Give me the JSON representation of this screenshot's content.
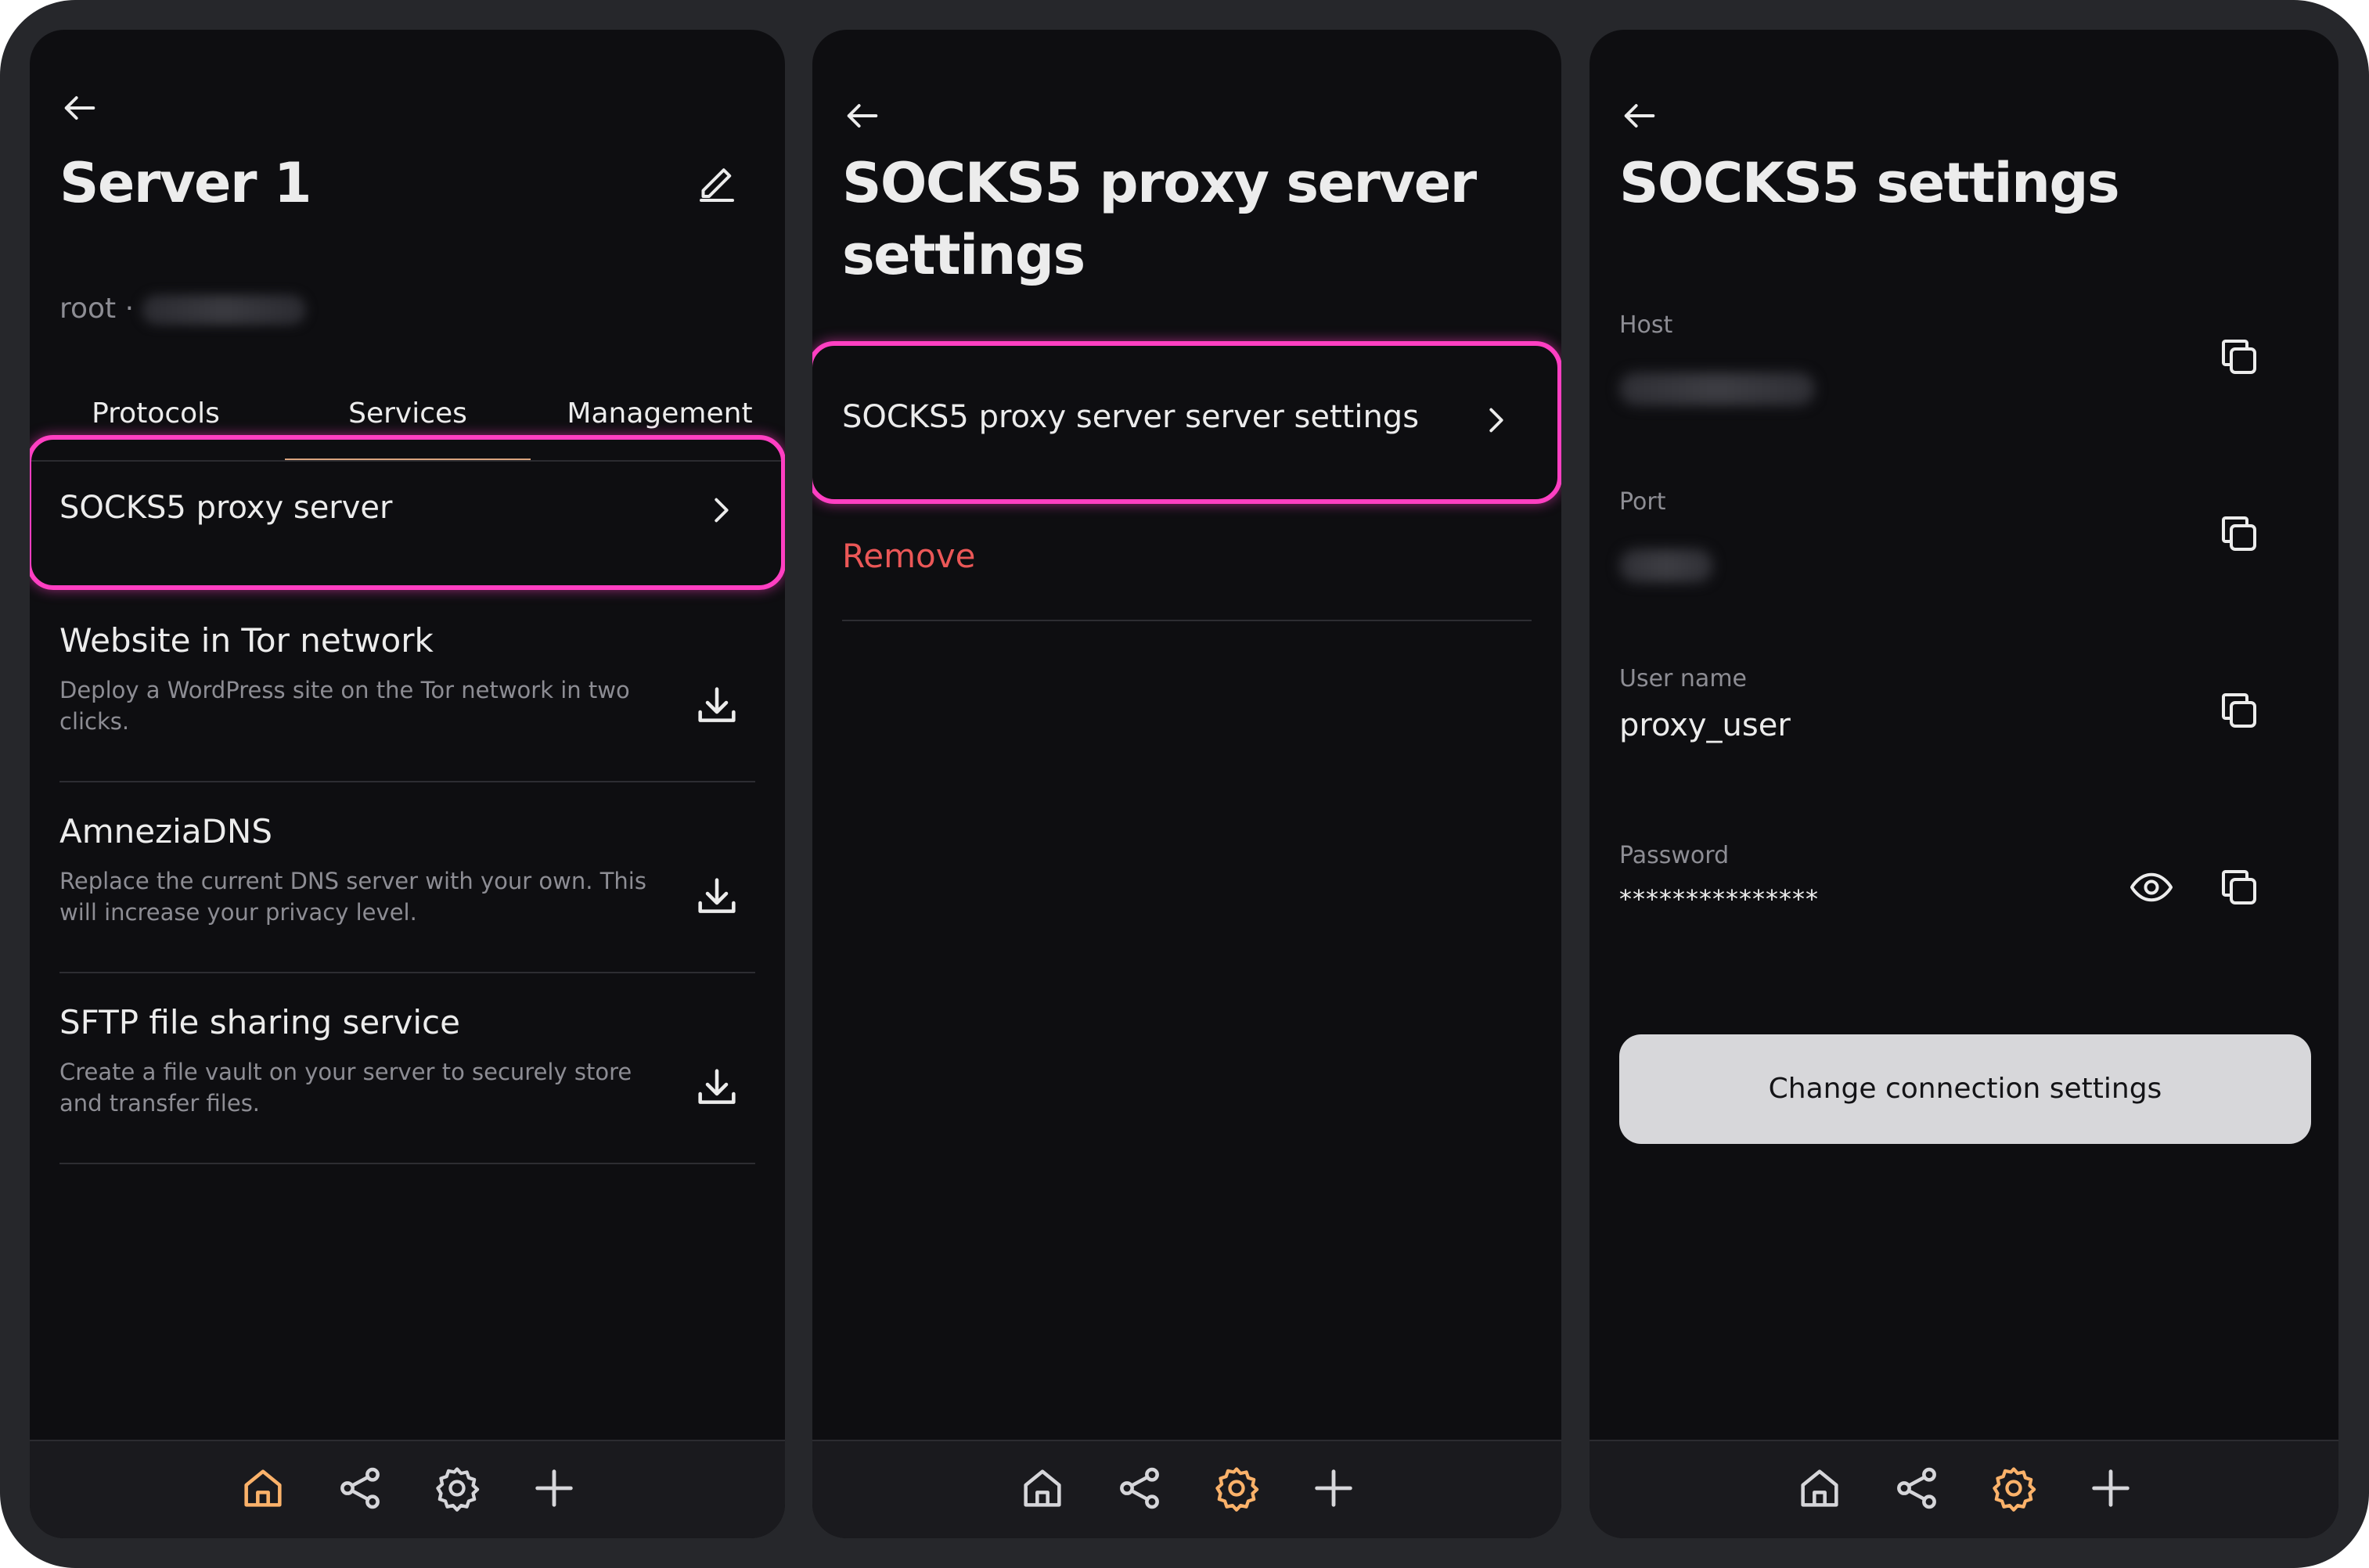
{
  "colors": {
    "accent": "#fbb26a",
    "highlight": "#ff3fc2",
    "danger": "#eb5757",
    "icon_default": "#d6d6da"
  },
  "panel1": {
    "title": "Server 1",
    "subtitle": "root ·",
    "tabs": [
      "Protocols",
      "Services",
      "Management"
    ],
    "active_tab": "Services",
    "selected_item": "SOCKS5 proxy server",
    "services": [
      {
        "title": "Website in Tor network",
        "description": "Deploy a WordPress site on the Tor network in two clicks."
      },
      {
        "title": "AmneziaDNS",
        "description": "Replace the current DNS server with your own. This will increase your privacy level."
      },
      {
        "title": "SFTP file sharing service",
        "description": "Create a file vault on your server to securely store and transfer files."
      }
    ],
    "icons": {
      "back": "arrow-left-icon",
      "edit": "pencil-icon",
      "chevron": "chevron-right-icon",
      "install": "download-icon"
    }
  },
  "panel2": {
    "title_line1": "SOCKS5 proxy server",
    "title_line2": "settings",
    "item": "SOCKS5 proxy server server settings",
    "remove": "Remove"
  },
  "panel3": {
    "title": "SOCKS5 settings",
    "fields": {
      "host": {
        "label": "Host"
      },
      "port": {
        "label": "Port"
      },
      "username": {
        "label": "User name",
        "value": "proxy_user"
      },
      "password": {
        "label": "Password",
        "value": "***************"
      }
    },
    "button": "Change connection settings",
    "icons": {
      "copy": "copy-icon",
      "show_password": "eye-icon"
    }
  },
  "navbar": {
    "items": [
      "home-icon",
      "share-icon",
      "settings-gear-icon",
      "plus-icon"
    ],
    "active": {
      "panel1": "home-icon",
      "panel2": "settings-gear-icon",
      "panel3": "settings-gear-icon"
    }
  }
}
